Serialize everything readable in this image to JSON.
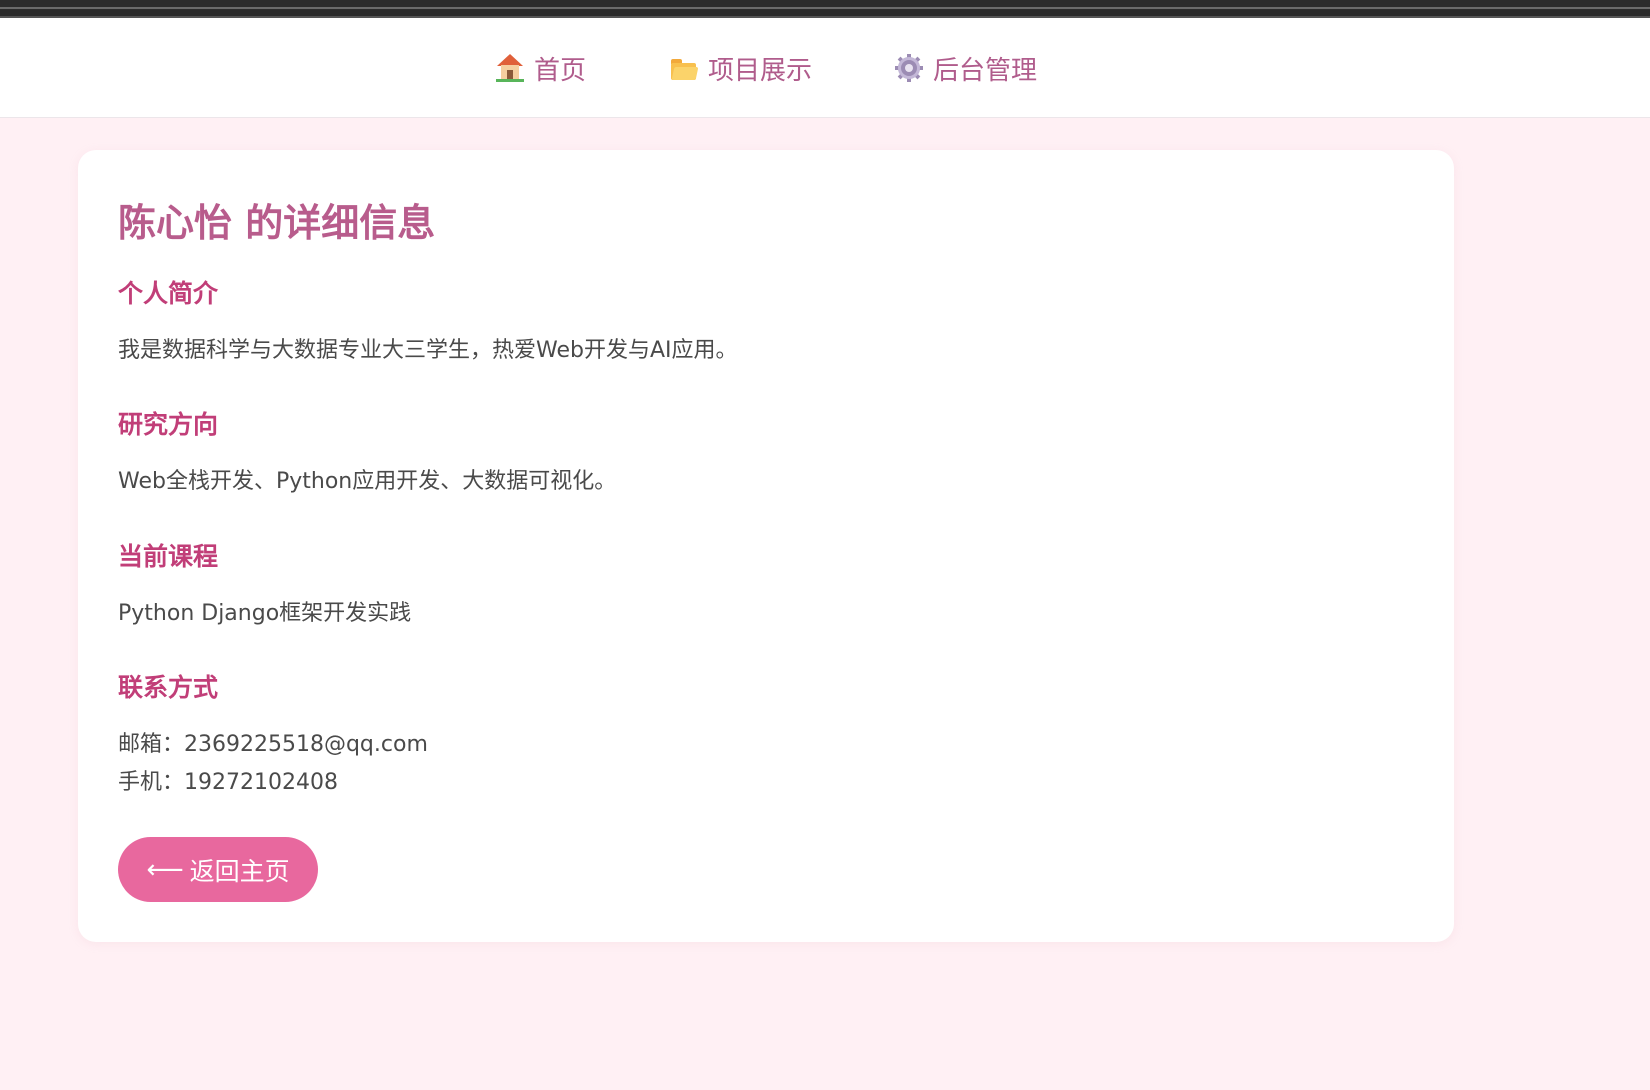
{
  "nav": {
    "items": [
      {
        "label": "首页",
        "icon": "house-icon"
      },
      {
        "label": "项目展示",
        "icon": "folder-icon"
      },
      {
        "label": "后台管理",
        "icon": "gear-icon"
      }
    ]
  },
  "profile": {
    "title": "陈心怡 的详细信息",
    "sections": {
      "intro": {
        "heading": "个人简介",
        "text": "我是数据科学与大数据专业大三学生，热爱Web开发与AI应用。"
      },
      "research": {
        "heading": "研究方向",
        "text": "Web全栈开发、Python应用开发、大数据可视化。"
      },
      "course": {
        "heading": "当前课程",
        "text": "Python Django框架开发实践"
      },
      "contact": {
        "heading": "联系方式",
        "email": "邮箱：2369225518@qq.com",
        "phone": "手机：19272102408"
      }
    },
    "back_button": {
      "arrow": "⟵",
      "label": "返回主页"
    }
  },
  "colors": {
    "background": "#fff0f4",
    "nav_text": "#b05c8c",
    "title": "#b85c8c",
    "section_heading": "#c13e78",
    "button": "#e8689e"
  }
}
